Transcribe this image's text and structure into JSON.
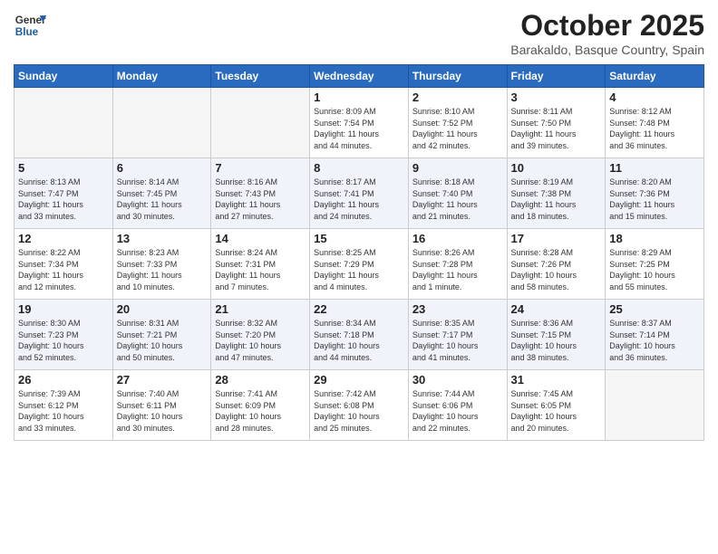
{
  "header": {
    "logo_general": "General",
    "logo_blue": "Blue",
    "month_title": "October 2025",
    "subtitle": "Barakaldo, Basque Country, Spain"
  },
  "weekdays": [
    "Sunday",
    "Monday",
    "Tuesday",
    "Wednesday",
    "Thursday",
    "Friday",
    "Saturday"
  ],
  "weeks": [
    [
      {
        "day": "",
        "info": "",
        "empty": true
      },
      {
        "day": "",
        "info": "",
        "empty": true
      },
      {
        "day": "",
        "info": "",
        "empty": true
      },
      {
        "day": "1",
        "info": "Sunrise: 8:09 AM\nSunset: 7:54 PM\nDaylight: 11 hours\nand 44 minutes."
      },
      {
        "day": "2",
        "info": "Sunrise: 8:10 AM\nSunset: 7:52 PM\nDaylight: 11 hours\nand 42 minutes."
      },
      {
        "day": "3",
        "info": "Sunrise: 8:11 AM\nSunset: 7:50 PM\nDaylight: 11 hours\nand 39 minutes."
      },
      {
        "day": "4",
        "info": "Sunrise: 8:12 AM\nSunset: 7:48 PM\nDaylight: 11 hours\nand 36 minutes."
      }
    ],
    [
      {
        "day": "5",
        "info": "Sunrise: 8:13 AM\nSunset: 7:47 PM\nDaylight: 11 hours\nand 33 minutes."
      },
      {
        "day": "6",
        "info": "Sunrise: 8:14 AM\nSunset: 7:45 PM\nDaylight: 11 hours\nand 30 minutes."
      },
      {
        "day": "7",
        "info": "Sunrise: 8:16 AM\nSunset: 7:43 PM\nDaylight: 11 hours\nand 27 minutes."
      },
      {
        "day": "8",
        "info": "Sunrise: 8:17 AM\nSunset: 7:41 PM\nDaylight: 11 hours\nand 24 minutes."
      },
      {
        "day": "9",
        "info": "Sunrise: 8:18 AM\nSunset: 7:40 PM\nDaylight: 11 hours\nand 21 minutes."
      },
      {
        "day": "10",
        "info": "Sunrise: 8:19 AM\nSunset: 7:38 PM\nDaylight: 11 hours\nand 18 minutes."
      },
      {
        "day": "11",
        "info": "Sunrise: 8:20 AM\nSunset: 7:36 PM\nDaylight: 11 hours\nand 15 minutes."
      }
    ],
    [
      {
        "day": "12",
        "info": "Sunrise: 8:22 AM\nSunset: 7:34 PM\nDaylight: 11 hours\nand 12 minutes."
      },
      {
        "day": "13",
        "info": "Sunrise: 8:23 AM\nSunset: 7:33 PM\nDaylight: 11 hours\nand 10 minutes."
      },
      {
        "day": "14",
        "info": "Sunrise: 8:24 AM\nSunset: 7:31 PM\nDaylight: 11 hours\nand 7 minutes."
      },
      {
        "day": "15",
        "info": "Sunrise: 8:25 AM\nSunset: 7:29 PM\nDaylight: 11 hours\nand 4 minutes."
      },
      {
        "day": "16",
        "info": "Sunrise: 8:26 AM\nSunset: 7:28 PM\nDaylight: 11 hours\nand 1 minute."
      },
      {
        "day": "17",
        "info": "Sunrise: 8:28 AM\nSunset: 7:26 PM\nDaylight: 10 hours\nand 58 minutes."
      },
      {
        "day": "18",
        "info": "Sunrise: 8:29 AM\nSunset: 7:25 PM\nDaylight: 10 hours\nand 55 minutes."
      }
    ],
    [
      {
        "day": "19",
        "info": "Sunrise: 8:30 AM\nSunset: 7:23 PM\nDaylight: 10 hours\nand 52 minutes."
      },
      {
        "day": "20",
        "info": "Sunrise: 8:31 AM\nSunset: 7:21 PM\nDaylight: 10 hours\nand 50 minutes."
      },
      {
        "day": "21",
        "info": "Sunrise: 8:32 AM\nSunset: 7:20 PM\nDaylight: 10 hours\nand 47 minutes."
      },
      {
        "day": "22",
        "info": "Sunrise: 8:34 AM\nSunset: 7:18 PM\nDaylight: 10 hours\nand 44 minutes."
      },
      {
        "day": "23",
        "info": "Sunrise: 8:35 AM\nSunset: 7:17 PM\nDaylight: 10 hours\nand 41 minutes."
      },
      {
        "day": "24",
        "info": "Sunrise: 8:36 AM\nSunset: 7:15 PM\nDaylight: 10 hours\nand 38 minutes."
      },
      {
        "day": "25",
        "info": "Sunrise: 8:37 AM\nSunset: 7:14 PM\nDaylight: 10 hours\nand 36 minutes."
      }
    ],
    [
      {
        "day": "26",
        "info": "Sunrise: 7:39 AM\nSunset: 6:12 PM\nDaylight: 10 hours\nand 33 minutes."
      },
      {
        "day": "27",
        "info": "Sunrise: 7:40 AM\nSunset: 6:11 PM\nDaylight: 10 hours\nand 30 minutes."
      },
      {
        "day": "28",
        "info": "Sunrise: 7:41 AM\nSunset: 6:09 PM\nDaylight: 10 hours\nand 28 minutes."
      },
      {
        "day": "29",
        "info": "Sunrise: 7:42 AM\nSunset: 6:08 PM\nDaylight: 10 hours\nand 25 minutes."
      },
      {
        "day": "30",
        "info": "Sunrise: 7:44 AM\nSunset: 6:06 PM\nDaylight: 10 hours\nand 22 minutes."
      },
      {
        "day": "31",
        "info": "Sunrise: 7:45 AM\nSunset: 6:05 PM\nDaylight: 10 hours\nand 20 minutes."
      },
      {
        "day": "",
        "info": "",
        "empty": true
      }
    ]
  ]
}
